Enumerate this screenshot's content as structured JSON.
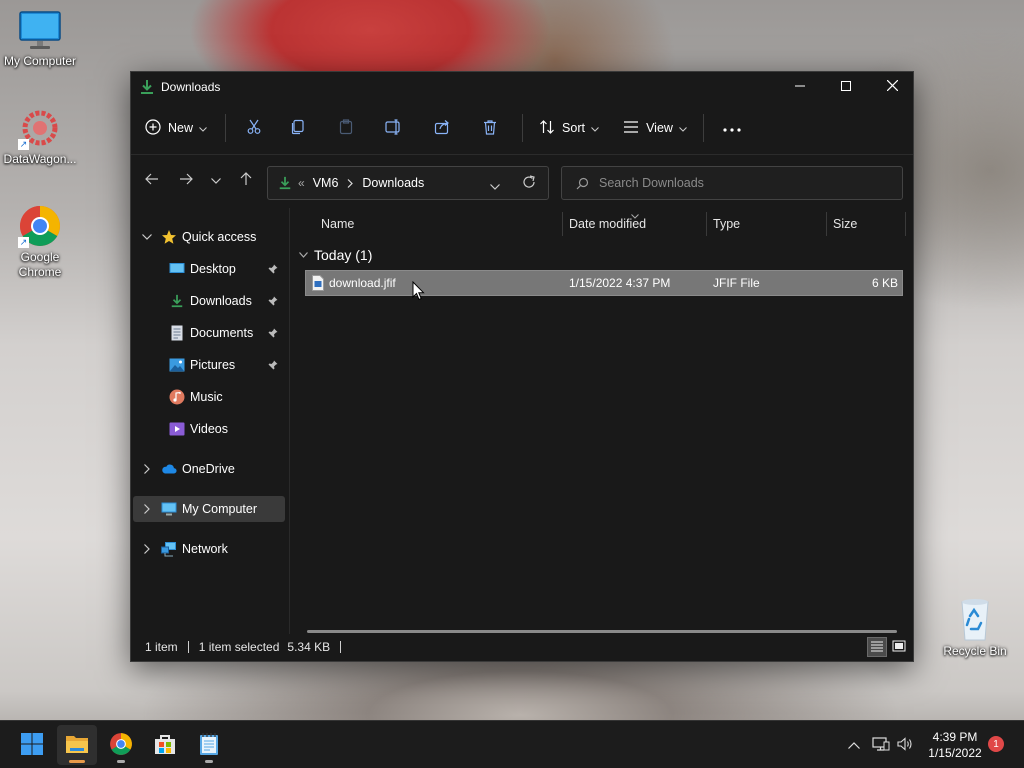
{
  "desktop": {
    "icons": [
      {
        "label": "My Computer",
        "icon": "monitor-icon"
      },
      {
        "label": "DataWagon...",
        "icon": "datawagon-icon"
      },
      {
        "label": "Google Chrome",
        "icon": "chrome-icon"
      },
      {
        "label": "Recycle Bin",
        "icon": "recycle-bin-icon"
      }
    ]
  },
  "window": {
    "title": "Downloads",
    "controls": {
      "minimize": "minimize-icon",
      "maximize": "maximize-icon",
      "close": "close-icon"
    }
  },
  "commandbar": {
    "new_label": "New",
    "sort_label": "Sort",
    "view_label": "View",
    "icons": [
      "plus-circle-icon",
      "cut-icon",
      "copy-icon",
      "paste-icon",
      "rename-icon",
      "share-icon",
      "delete-icon",
      "sort-icon",
      "view-lines-icon",
      "more-icon"
    ]
  },
  "address": {
    "overflow": "«",
    "crumbs": [
      "VM6",
      "Downloads"
    ],
    "search_placeholder": "Search Downloads"
  },
  "navpane": {
    "quick_access": "Quick access",
    "items": [
      {
        "label": "Desktop",
        "icon": "desktop-icon",
        "pinned": true
      },
      {
        "label": "Downloads",
        "icon": "downloads-icon",
        "pinned": true
      },
      {
        "label": "Documents",
        "icon": "documents-icon",
        "pinned": true
      },
      {
        "label": "Pictures",
        "icon": "pictures-icon",
        "pinned": true
      },
      {
        "label": "Music",
        "icon": "music-icon",
        "pinned": false
      },
      {
        "label": "Videos",
        "icon": "videos-icon",
        "pinned": false
      }
    ],
    "onedrive": "OneDrive",
    "mycomputer": "My Computer",
    "network": "Network"
  },
  "content": {
    "columns": {
      "name": "Name",
      "date": "Date modified",
      "type": "Type",
      "size": "Size"
    },
    "group_label": "Today (1)",
    "files": [
      {
        "name": "download.jfif",
        "date": "1/15/2022 4:37 PM",
        "type": "JFIF File",
        "size": "6 KB",
        "selected": true
      }
    ]
  },
  "status": {
    "count": "1 item",
    "selection": "1 item selected",
    "size": "5.34 KB"
  },
  "taskbar": {
    "apps": [
      "start-icon",
      "file-explorer-icon",
      "chrome-icon",
      "store-icon",
      "notepad-icon"
    ],
    "time": "4:39 PM",
    "date": "1/15/2022",
    "notifications": "1"
  },
  "colors": {
    "window_bg": "#191919",
    "selection": "#777777",
    "accent_green": "#3aa05a",
    "badge_red": "#e04848"
  }
}
